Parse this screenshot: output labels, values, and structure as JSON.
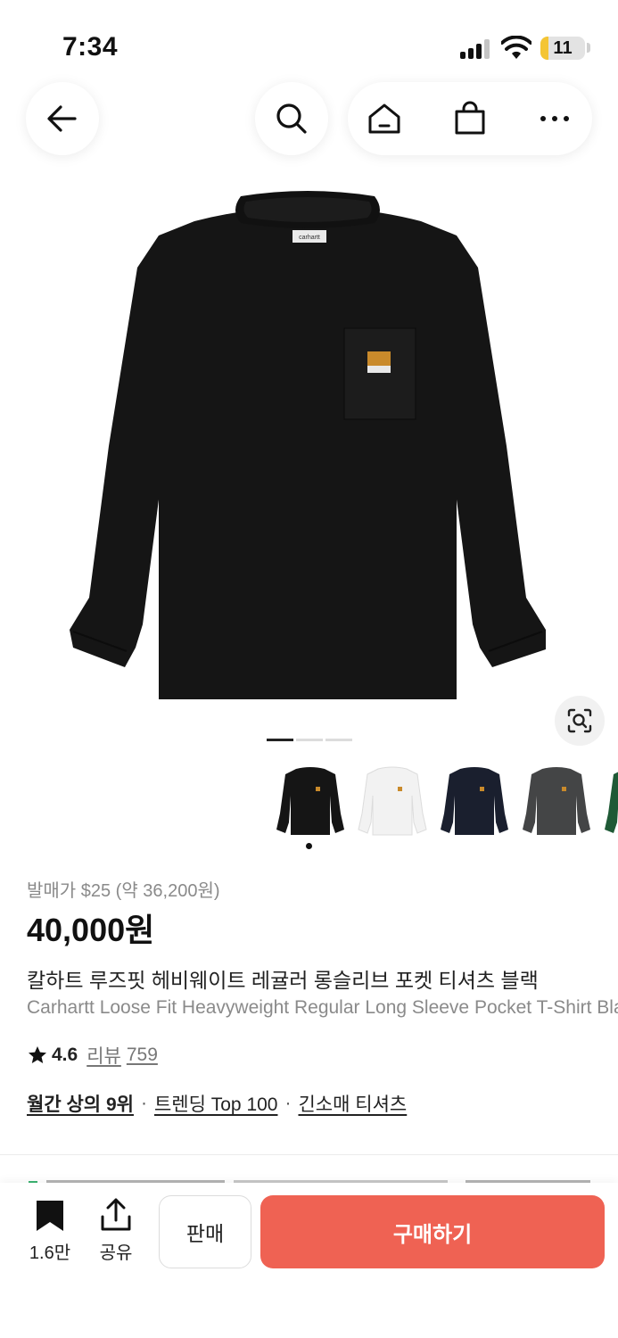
{
  "status_bar": {
    "time": "7:34",
    "battery_level": "11"
  },
  "header": {
    "back_icon": "arrow-left-icon",
    "search_icon": "search-icon",
    "home_icon": "home-icon",
    "bag_icon": "shopping-bag-icon",
    "more_icon": "more-dots-icon"
  },
  "gallery": {
    "current_index": 1,
    "total_images": 3,
    "lens_icon": "image-search-icon",
    "color_options": [
      "black",
      "white",
      "navy",
      "charcoal",
      "green"
    ],
    "selected_color": "black"
  },
  "product": {
    "release_price": "발매가 $25 (약 36,200원)",
    "price": "40,000원",
    "name_ko": "칼하트 루즈핏 헤비웨이트 레귤러 롱슬리브 포켓 티셔츠 블랙",
    "name_en": "Carhartt Loose Fit Heavyweight Regular Long Sleeve Pocket T-Shirt Black",
    "rating": "4.6",
    "reviews_label": "리뷰",
    "reviews_count": "759"
  },
  "tags": [
    {
      "label": "월간 상의 9위",
      "bold": true
    },
    {
      "label": "트렌딩 Top 100",
      "bold": false
    },
    {
      "label": "긴소매 티셔츠",
      "bold": false
    }
  ],
  "bottom_bar": {
    "bookmark_count": "1.6만",
    "share_label": "공유",
    "sell_label": "판매",
    "buy_label": "구매하기"
  },
  "colors": {
    "buy_button": "#ef6253",
    "battery_fill": "#f4c534",
    "text_primary": "#111111",
    "text_secondary": "#8a8a8a"
  }
}
